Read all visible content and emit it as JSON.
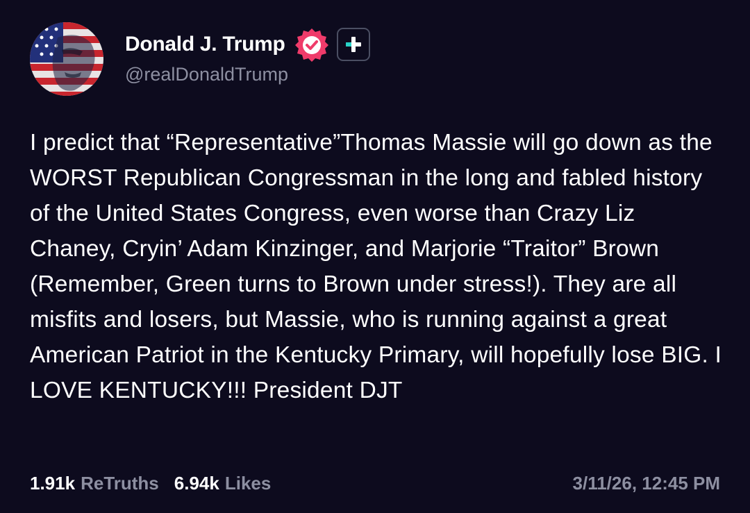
{
  "author": {
    "display_name": "Donald J. Trump",
    "handle": "@realDonaldTrump",
    "avatar_icon": "flag-portrait-avatar",
    "verified_icon": "verified-badge-icon",
    "plus_icon": "plus-badge-icon"
  },
  "post": {
    "text": "I predict that “Representative”Thomas Massie will go down as the WORST Republican Congressman in the long and fabled history of the United States Congress, even worse than Crazy Liz Chaney, Cryin’ Adam Kinzinger, and Marjorie “Traitor” Brown (Remember, Green turns to Brown under stress!). They are all misfits and losers, but Massie, who is running against a great American Patriot in the Kentucky Primary, will hopefully lose BIG. I LOVE KENTUCKY!!! President DJT"
  },
  "stats": {
    "retruths_count": "1.91k",
    "retruths_label": "ReTruths",
    "likes_count": "6.94k",
    "likes_label": "Likes"
  },
  "timestamp": "3/11/26, 12:45 PM",
  "colors": {
    "background": "#0d0b1e",
    "text_primary": "#ffffff",
    "text_secondary": "#8d8fa1",
    "verified_badge": "#ef3b6a",
    "plus_accent": "#27d3c8"
  }
}
